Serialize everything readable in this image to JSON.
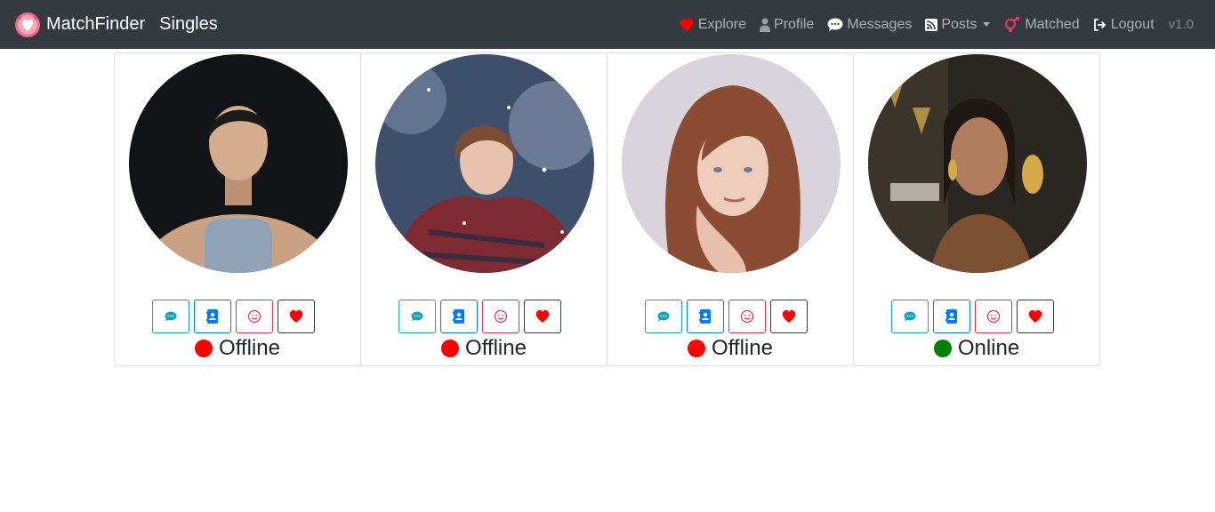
{
  "navbar": {
    "brand": "MatchFinder",
    "page_title": "Singles",
    "items": [
      {
        "label": "Explore",
        "icon": "heart-icon",
        "color": "#ff0000"
      },
      {
        "label": "Profile",
        "icon": "user-icon"
      },
      {
        "label": "Messages",
        "icon": "comment-icon"
      },
      {
        "label": "Posts",
        "icon": "rss-icon",
        "dropdown": true
      },
      {
        "label": "Matched",
        "icon": "mars-venus-icon",
        "color": "#e83e5c"
      },
      {
        "label": "Logout",
        "icon": "logout-icon"
      }
    ],
    "version": "v1.0"
  },
  "profiles": [
    {
      "status": "Offline",
      "status_color": "#ff0000"
    },
    {
      "status": "Offline",
      "status_color": "#ff0000"
    },
    {
      "status": "Offline",
      "status_color": "#ff0000"
    },
    {
      "status": "Online",
      "status_color": "#008000"
    }
  ],
  "colors": {
    "navbar_bg": "#343a40",
    "chat": "#17a2b8",
    "contact": "#007bff",
    "smile": "#dc3545",
    "heart": "#ff0000"
  }
}
